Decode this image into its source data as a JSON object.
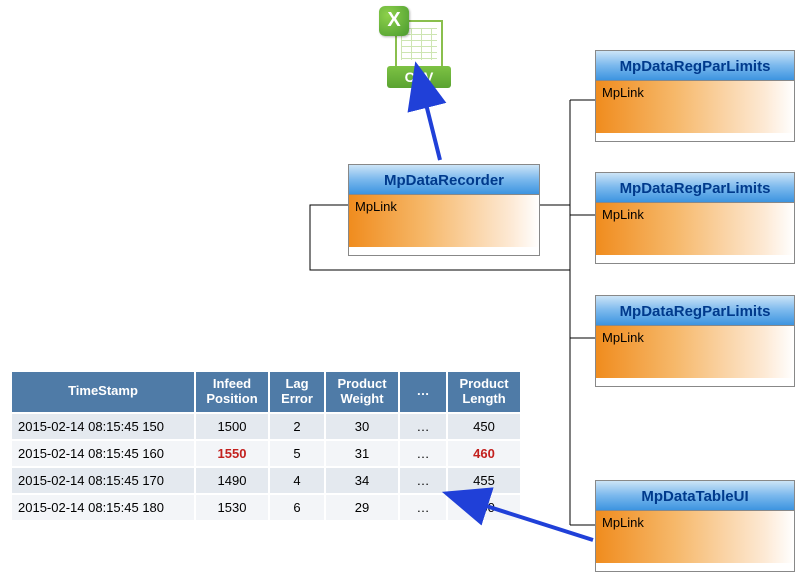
{
  "icon": {
    "x_letter": "X",
    "csv_label": "CSV"
  },
  "blocks": {
    "recorder": {
      "title": "MpDataRecorder",
      "sub": "MpLink"
    },
    "limits1": {
      "title": "MpDataRegParLimits",
      "sub": "MpLink"
    },
    "limits2": {
      "title": "MpDataRegParLimits",
      "sub": "MpLink"
    },
    "limits3": {
      "title": "MpDataRegParLimits",
      "sub": "MpLink"
    },
    "tableui": {
      "title": "MpDataTableUI",
      "sub": "MpLink"
    }
  },
  "table": {
    "headers": {
      "c0": "TimeStamp",
      "c1a": "Infeed",
      "c1b": "Position",
      "c2a": "Lag",
      "c2b": "Error",
      "c3a": "Product",
      "c3b": "Weight",
      "c4": "…",
      "c5a": "Product",
      "c5b": "Length"
    },
    "rows": [
      {
        "ts": "2015-02-14 08:15:45 150",
        "infeed": "1500",
        "lag": "2",
        "weight": "30",
        "dots": "…",
        "length": "450",
        "infeed_red": false,
        "length_red": false
      },
      {
        "ts": "2015-02-14 08:15:45 160",
        "infeed": "1550",
        "lag": "5",
        "weight": "31",
        "dots": "…",
        "length": "460",
        "infeed_red": true,
        "length_red": true
      },
      {
        "ts": "2015-02-14 08:15:45 170",
        "infeed": "1490",
        "lag": "4",
        "weight": "34",
        "dots": "…",
        "length": "455",
        "infeed_red": false,
        "length_red": false
      },
      {
        "ts": "2015-02-14 08:15:45 180",
        "infeed": "1530",
        "lag": "6",
        "weight": "29",
        "dots": "…",
        "length": "450",
        "infeed_red": false,
        "length_red": false
      }
    ]
  }
}
